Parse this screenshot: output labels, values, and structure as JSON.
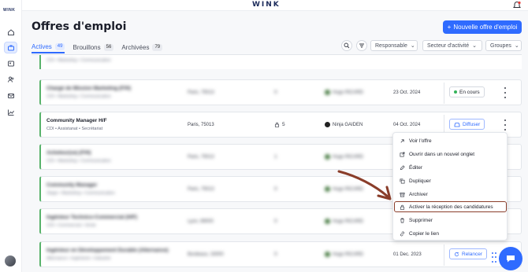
{
  "header": {
    "brand": "WINK"
  },
  "sidebar": {
    "logo": "WINK"
  },
  "page": {
    "title": "Offres d'emploi",
    "new_button": "Nouvelle offre d'emploi"
  },
  "tabs": [
    {
      "label": "Actives",
      "count": "49"
    },
    {
      "label": "Brouillons",
      "count": "56"
    },
    {
      "label": "Archivées",
      "count": "79"
    }
  ],
  "filters": {
    "responsable": "Responsable",
    "secteur": "Secteur d'activité",
    "groupes": "Groupes"
  },
  "rows": [
    {
      "name": "Chargé de Mission Marketing (F/H)",
      "sub": "CDI • Marketing • Communication",
      "loc": "Paris, 75013",
      "cands": "0",
      "resp": "Hugo RICARD",
      "date": "23 Oct. 2024",
      "status": "En cours"
    },
    {
      "name": "Community Manager H/F",
      "sub": "CDI • Assistanat • Secrétariat",
      "loc": "Paris, 75013",
      "cands": "5",
      "resp": "Ninja GAIDEN",
      "date": "04 Oct. 2024",
      "action": "Diffuser"
    },
    {
      "name": "Acheteur(se) (F/H)",
      "sub": "CDI • Marketing • Communication",
      "loc": "Paris, 75013",
      "cands": "1",
      "resp": "Hugo RICARD",
      "date": "",
      "action": ""
    },
    {
      "name": "Community Manager",
      "sub": "Stage • Marketing • Communication",
      "loc": "Paris, 75013",
      "cands": "0",
      "resp": "Hugo RICARD",
      "date": "",
      "action": ""
    },
    {
      "name": "Ingénieur Technico-Commercial (H/F)",
      "sub": "CDI • Commercial • Vente",
      "loc": "Lyon, 69000",
      "cands": "0",
      "resp": "Hugo RICARD",
      "date": "",
      "action": ""
    },
    {
      "name": "Ingénieur en Développement Durable (Alternance)",
      "sub": "Alternance • Ingénierie • Industrie",
      "loc": "Bordeaux, 33000",
      "cands": "0",
      "resp": "Hugo RICARD",
      "date": "01 Dec. 2023",
      "action": "Relancer"
    }
  ],
  "menu": {
    "items": [
      {
        "label": "Voir l'offre",
        "icon": "external-link-icon"
      },
      {
        "label": "Ouvrir dans un nouvel onglet",
        "icon": "new-tab-icon"
      },
      {
        "label": "Éditer",
        "icon": "pencil-icon"
      },
      {
        "label": "Dupliquer",
        "icon": "copy-icon"
      },
      {
        "label": "Archiver",
        "icon": "archive-icon"
      },
      {
        "label": "Activer la réception des candidatures",
        "icon": "lock-icon"
      },
      {
        "label": "Supprimer",
        "icon": "trash-icon"
      },
      {
        "label": "Copier le lien",
        "icon": "link-icon"
      }
    ]
  },
  "colors": {
    "accent": "#2f6bff",
    "active_border": "#58b26b",
    "annotation": "#8a3d2a"
  }
}
